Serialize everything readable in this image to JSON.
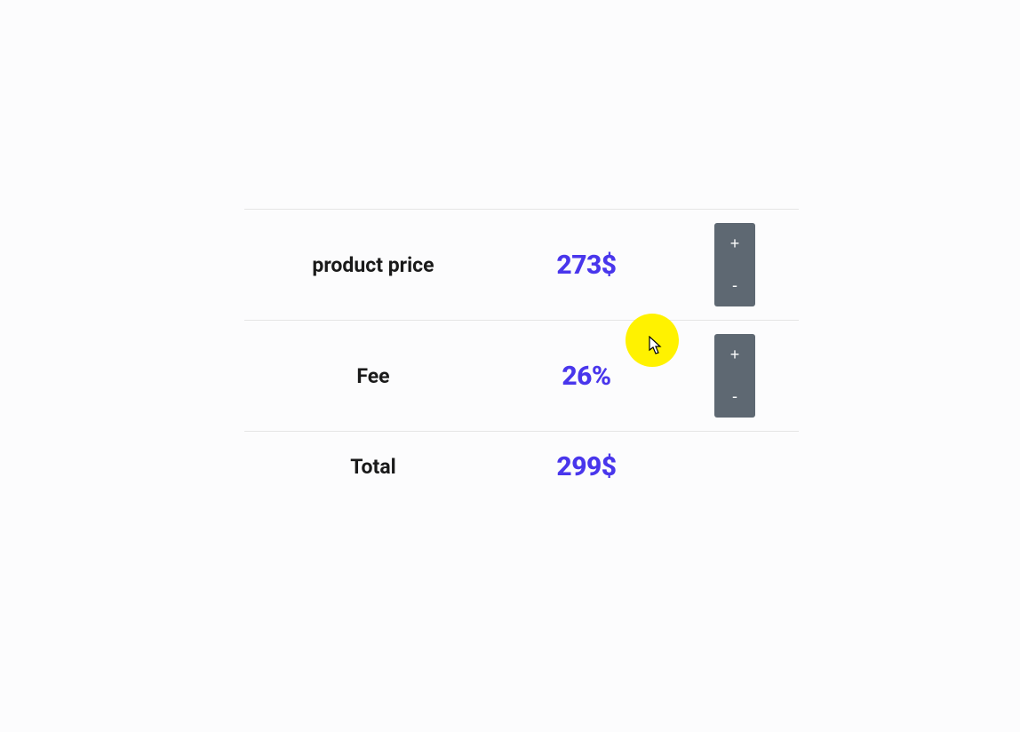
{
  "rows": {
    "price": {
      "label": "product price",
      "value": "273$"
    },
    "fee": {
      "label": "Fee",
      "value": "26%"
    },
    "total": {
      "label": "Total",
      "value": "299$"
    }
  },
  "stepper": {
    "inc": "+",
    "dec": "-"
  }
}
